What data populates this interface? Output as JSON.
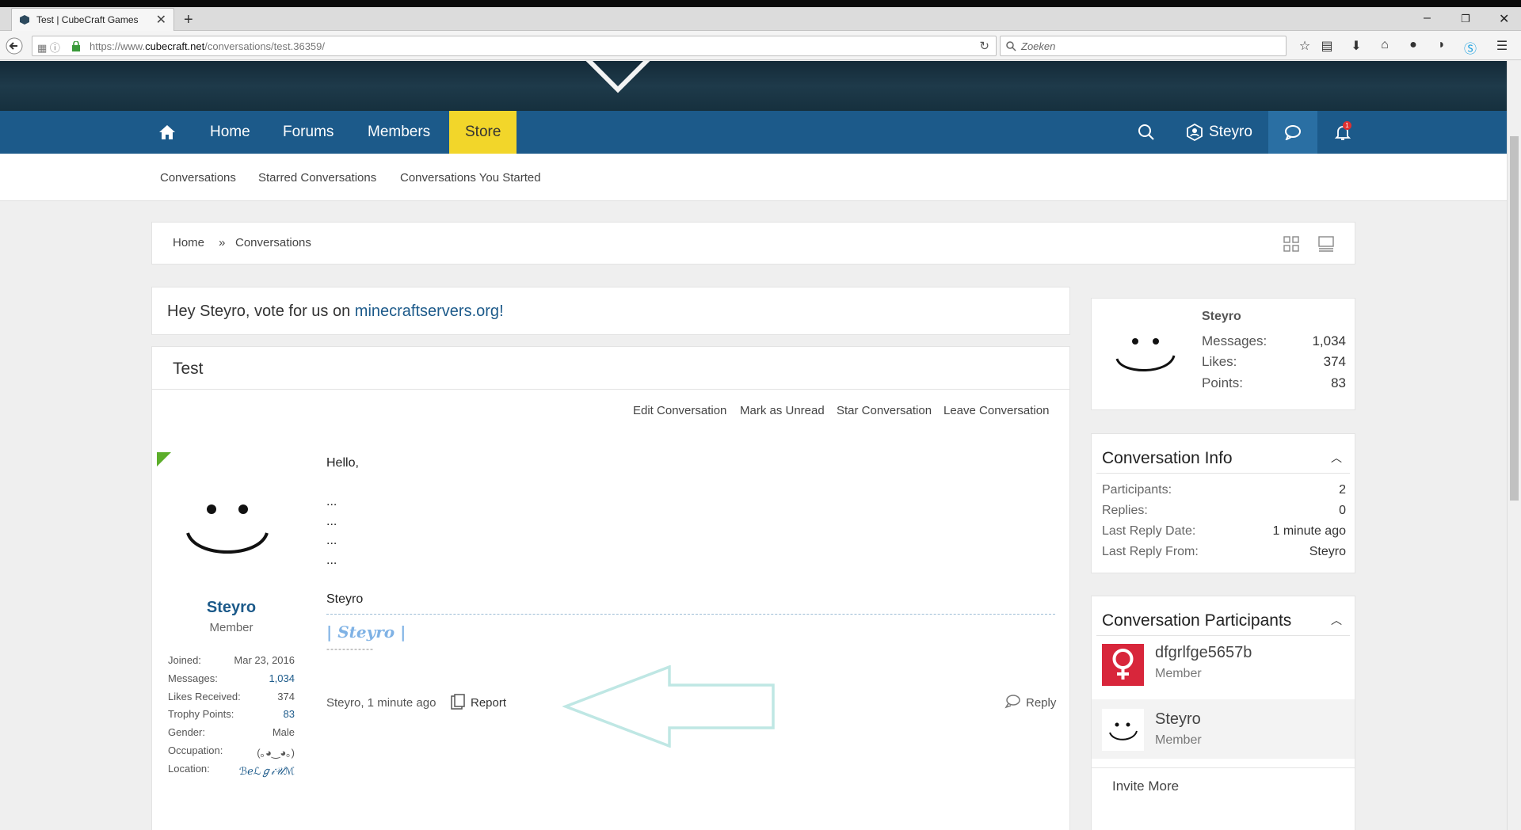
{
  "browser": {
    "tab_title": "Test | CubeCraft Games",
    "url_prefix": "https://www.",
    "url_domain": "cubecraft.net",
    "url_path": "/conversations/test.36359/",
    "search_placeholder": "Zoeken"
  },
  "nav": {
    "home": "Home",
    "forums": "Forums",
    "members": "Members",
    "store": "Store",
    "user": "Steyro",
    "notification_count": "1"
  },
  "subnav": [
    "Conversations",
    "Starred Conversations",
    "Conversations You Started"
  ],
  "breadcrumb": {
    "home": "Home",
    "sep": "»",
    "current": "Conversations"
  },
  "vote": {
    "prefix": "Hey Steyro, vote for us on ",
    "link": "minecraftservers.org",
    "suffix": "!"
  },
  "conversation": {
    "title": "Test",
    "actions": [
      "Edit Conversation",
      "Mark as Unread",
      "Star Conversation",
      "Leave Conversation"
    ],
    "message": {
      "lines": [
        "Hello,",
        "",
        "...",
        "...",
        "...",
        "...",
        "",
        "Steyro"
      ],
      "signature": "| Steyro |",
      "signature_line": "------------",
      "byline": "Steyro, 1 minute ago",
      "report": "Report",
      "reply": "Reply"
    },
    "author": {
      "name": "Steyro",
      "title": "Member",
      "stats": [
        {
          "label": "Joined:",
          "value": "Mar 23, 2016"
        },
        {
          "label": "Messages:",
          "value": "1,034"
        },
        {
          "label": "Likes Received:",
          "value": "374"
        },
        {
          "label": "Trophy Points:",
          "value": "83"
        },
        {
          "label": "Gender:",
          "value": "Male"
        },
        {
          "label": "Occupation:",
          "value": "(｡◕‿◕｡)"
        },
        {
          "label": "Location:",
          "value": "ℬℯℒℊ𝒾𝒰ℳ"
        }
      ]
    }
  },
  "sidebar": {
    "profile": {
      "name": "Steyro",
      "stats": [
        {
          "label": "Messages:",
          "value": "1,034"
        },
        {
          "label": "Likes:",
          "value": "374"
        },
        {
          "label": "Points:",
          "value": "83"
        }
      ]
    },
    "info": {
      "title": "Conversation Info",
      "rows": [
        {
          "label": "Participants:",
          "value": "2"
        },
        {
          "label": "Replies:",
          "value": "0"
        },
        {
          "label": "Last Reply Date:",
          "value": "1 minute ago"
        },
        {
          "label": "Last Reply From:",
          "value": "Steyro"
        }
      ]
    },
    "participants": {
      "title": "Conversation Participants",
      "list": [
        {
          "name": "dfgrlfge5657b",
          "role": "Member"
        },
        {
          "name": "Steyro",
          "role": "Member"
        }
      ],
      "invite": "Invite More"
    }
  },
  "colors": {
    "nav": "#1c5a8a",
    "store": "#f2d62a",
    "link": "#1c5a8a",
    "arrow": "#bfe7e4"
  }
}
